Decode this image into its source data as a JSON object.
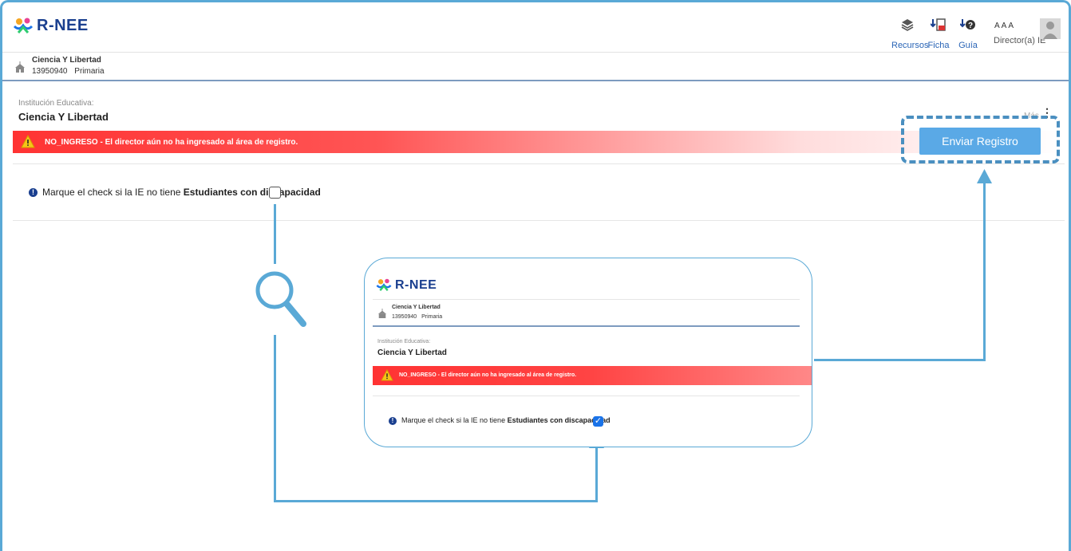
{
  "app": {
    "name": "R-NEE"
  },
  "header": {
    "resources_label": "Recursos",
    "ficha_label": "Ficha",
    "guide_label": "Guía",
    "user_initials": "AAA",
    "user_role": "Director(a) IE"
  },
  "school": {
    "name": "Ciencia Y Libertad",
    "code": "13950940",
    "level": "Primaria"
  },
  "main": {
    "ie_label": "Institución Educativa:",
    "ie_name": "Ciencia Y Libertad",
    "more_label": "Más",
    "status_text": "NO_INGRESO - El director aún no ha ingresado al área de registro.",
    "send_button_label": "Enviar Registro",
    "check_text_prefix": "Marque el check si la IE no tiene",
    "check_text_bold": "Estudiantes con discapacidad"
  },
  "inset": {
    "app_name": "R-NEE",
    "school_name": "Ciencia Y Libertad",
    "school_code": "13950940",
    "school_level": "Primaria",
    "ie_label": "Institución Educativa:",
    "ie_name": "Ciencia Y Libertad",
    "status_text": "NO_INGRESO - El director aún no ha ingresado al área de registro.",
    "check_text_prefix": "Marque el check si la IE no tiene",
    "check_text_bold": "Estudiantes con discapacidad",
    "checked": true
  },
  "colors": {
    "accent": "#5aa9d6",
    "brand": "#1a3f8f",
    "alert": "#ff3333",
    "button": "#5aa9e6"
  }
}
